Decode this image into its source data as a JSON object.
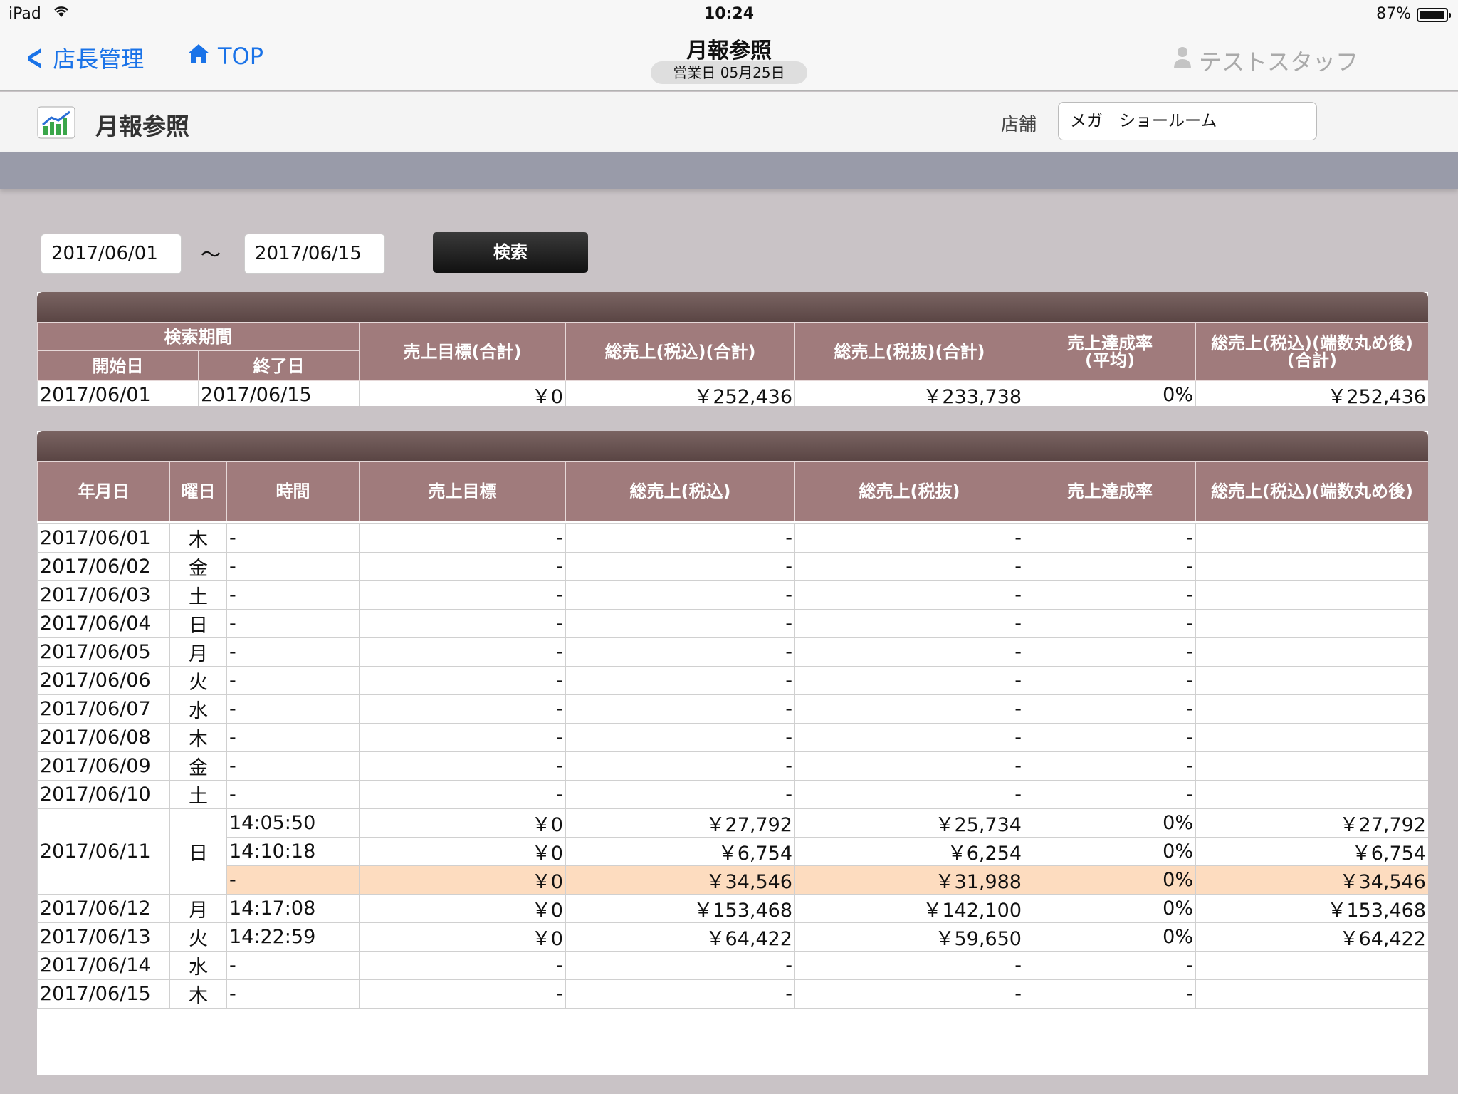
{
  "status_bar": {
    "carrier": "iPad",
    "time": "10:24",
    "battery": "87%"
  },
  "nav": {
    "back_label": "店長管理",
    "top_label": "TOP",
    "title": "月報参照",
    "subtitle": "営業日 05月25日",
    "staff": "テストスタッフ"
  },
  "header": {
    "title": "月報参照",
    "store_label": "店舗",
    "store_value": "メガ　ショールーム"
  },
  "search": {
    "start": "2017/06/01",
    "tilde": "〜",
    "end": "2017/06/15",
    "button": "検索"
  },
  "summary": {
    "group_header": "検索期間",
    "col_start": "開始日",
    "col_end": "終了日",
    "col_target": "売上目標(合計)",
    "col_gross_tax": "総売上(税込)(合計)",
    "col_gross_net": "総売上(税抜)(合計)",
    "col_rate_line1": "売上達成率",
    "col_rate_line2": "(平均)",
    "col_rounded_line1": "総売上(税込)(端数丸め後)",
    "col_rounded_line2": "(合計)",
    "row": [
      "2017/06/01",
      "2017/06/15",
      "￥0",
      "￥252,436",
      "￥233,738",
      "0%",
      "￥252,436"
    ]
  },
  "detail": {
    "headers": [
      "年月日",
      "曜日",
      "時間",
      "売上目標",
      "総売上(税込)",
      "総売上(税抜)",
      "売上達成率",
      "総売上(税込)(端数丸め後)"
    ],
    "rows": [
      {
        "date": "2017/06/01",
        "dow": "木",
        "time": "-",
        "target": "-",
        "gross": "-",
        "net": "-",
        "rate": "-",
        "rounded": ""
      },
      {
        "date": "2017/06/02",
        "dow": "金",
        "time": "-",
        "target": "-",
        "gross": "-",
        "net": "-",
        "rate": "-",
        "rounded": ""
      },
      {
        "date": "2017/06/03",
        "dow": "土",
        "time": "-",
        "target": "-",
        "gross": "-",
        "net": "-",
        "rate": "-",
        "rounded": ""
      },
      {
        "date": "2017/06/04",
        "dow": "日",
        "time": "-",
        "target": "-",
        "gross": "-",
        "net": "-",
        "rate": "-",
        "rounded": ""
      },
      {
        "date": "2017/06/05",
        "dow": "月",
        "time": "-",
        "target": "-",
        "gross": "-",
        "net": "-",
        "rate": "-",
        "rounded": ""
      },
      {
        "date": "2017/06/06",
        "dow": "火",
        "time": "-",
        "target": "-",
        "gross": "-",
        "net": "-",
        "rate": "-",
        "rounded": ""
      },
      {
        "date": "2017/06/07",
        "dow": "水",
        "time": "-",
        "target": "-",
        "gross": "-",
        "net": "-",
        "rate": "-",
        "rounded": ""
      },
      {
        "date": "2017/06/08",
        "dow": "木",
        "time": "-",
        "target": "-",
        "gross": "-",
        "net": "-",
        "rate": "-",
        "rounded": ""
      },
      {
        "date": "2017/06/09",
        "dow": "金",
        "time": "-",
        "target": "-",
        "gross": "-",
        "net": "-",
        "rate": "-",
        "rounded": ""
      },
      {
        "date": "2017/06/10",
        "dow": "土",
        "time": "-",
        "target": "-",
        "gross": "-",
        "net": "-",
        "rate": "-",
        "rounded": ""
      },
      {
        "date": "2017/06/11",
        "dow": "日",
        "time": "14:05:50",
        "target": "￥0",
        "gross": "￥27,792",
        "net": "￥25,734",
        "rate": "0%",
        "rounded": "￥27,792",
        "span": 3
      },
      {
        "time": "14:10:18",
        "target": "￥0",
        "gross": "￥6,754",
        "net": "￥6,254",
        "rate": "0%",
        "rounded": "￥6,754",
        "cont": true
      },
      {
        "time": "-",
        "target": "￥0",
        "gross": "￥34,546",
        "net": "￥31,988",
        "rate": "0%",
        "rounded": "￥34,546",
        "cont": true,
        "total": true
      },
      {
        "date": "2017/06/12",
        "dow": "月",
        "time": "14:17:08",
        "target": "￥0",
        "gross": "￥153,468",
        "net": "￥142,100",
        "rate": "0%",
        "rounded": "￥153,468"
      },
      {
        "date": "2017/06/13",
        "dow": "火",
        "time": "14:22:59",
        "target": "￥0",
        "gross": "￥64,422",
        "net": "￥59,650",
        "rate": "0%",
        "rounded": "￥64,422"
      },
      {
        "date": "2017/06/14",
        "dow": "水",
        "time": "-",
        "target": "-",
        "gross": "-",
        "net": "-",
        "rate": "-",
        "rounded": ""
      },
      {
        "date": "2017/06/15",
        "dow": "木",
        "time": "-",
        "target": "-",
        "gross": "-",
        "net": "-",
        "rate": "-",
        "rounded": ""
      }
    ]
  }
}
